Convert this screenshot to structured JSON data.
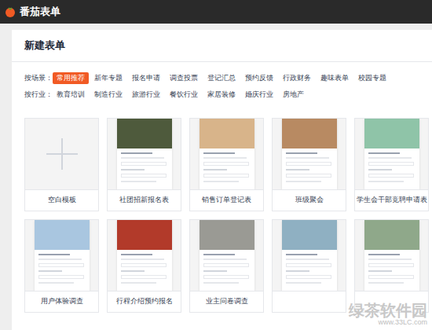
{
  "app": {
    "title": "番茄表单"
  },
  "page": {
    "title": "新建表单"
  },
  "scene_filter": {
    "label": "按场景：",
    "items": [
      {
        "label": "常用推荐",
        "selected": true
      },
      {
        "label": "新年专题",
        "selected": false
      },
      {
        "label": "报名申请",
        "selected": false
      },
      {
        "label": "调查投票",
        "selected": false
      },
      {
        "label": "登记汇总",
        "selected": false
      },
      {
        "label": "预约反馈",
        "selected": false
      },
      {
        "label": "行政财务",
        "selected": false
      },
      {
        "label": "趣味表单",
        "selected": false
      },
      {
        "label": "校园专题",
        "selected": false
      }
    ]
  },
  "industry_filter": {
    "label": "按行业：",
    "items": [
      {
        "label": "教育培训",
        "selected": false
      },
      {
        "label": "制造行业",
        "selected": false
      },
      {
        "label": "旅游行业",
        "selected": false
      },
      {
        "label": "餐饮行业",
        "selected": false
      },
      {
        "label": "家居装修",
        "selected": false
      },
      {
        "label": "婚庆行业",
        "selected": false
      },
      {
        "label": "房地产",
        "selected": false
      }
    ]
  },
  "templates": [
    [
      {
        "kind": "blank",
        "label": "空白模板"
      },
      {
        "kind": "template",
        "label": "社团招新报名表"
      },
      {
        "kind": "template",
        "label": "销售订单登记表"
      },
      {
        "kind": "template",
        "label": "班级聚会"
      },
      {
        "kind": "template",
        "label": "学生会干部竞聘申请表"
      }
    ],
    [
      {
        "kind": "template",
        "label": "用户体验调查"
      },
      {
        "kind": "template",
        "label": "行程介绍预约报名"
      },
      {
        "kind": "template",
        "label": "业主问卷调查"
      },
      {
        "kind": "template",
        "label": ""
      },
      {
        "kind": "template",
        "label": ""
      }
    ]
  ],
  "watermark": {
    "name": "绿茶软件园",
    "url": "www.33LC.com"
  }
}
